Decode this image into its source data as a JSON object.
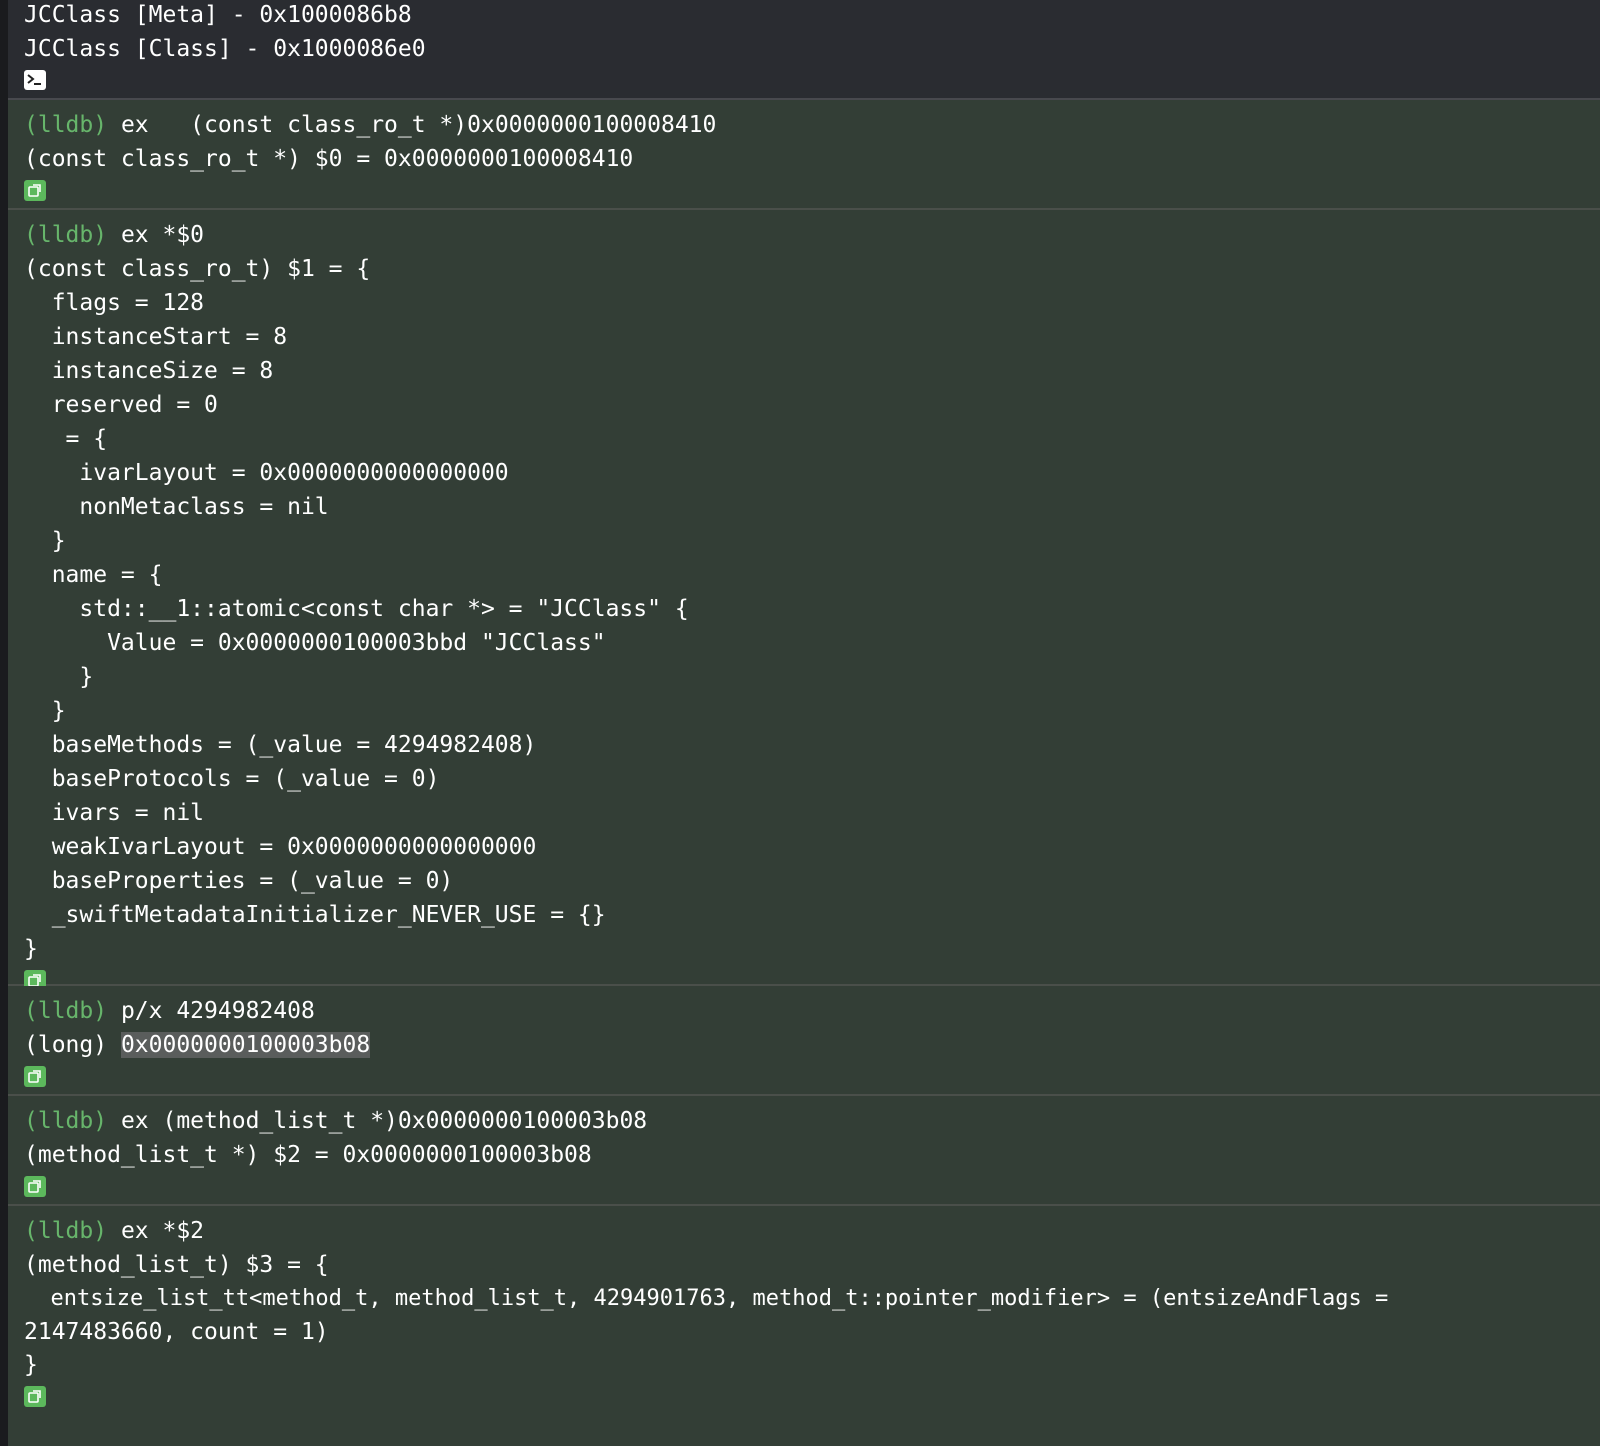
{
  "output": {
    "lines": [
      "JCClass [Meta] - 0x1000086b8",
      "JCClass [Class] - 0x1000086e0"
    ]
  },
  "blocks": [
    {
      "prompt": "(lldb)",
      "command": " ex   (const class_ro_t *)0x0000000100008410",
      "result": [
        "(const class_ro_t *) $0 = 0x0000000100008410"
      ]
    },
    {
      "prompt": "(lldb)",
      "command": " ex *$0",
      "result": [
        "(const class_ro_t) $1 = {",
        "  flags = 128",
        "  instanceStart = 8",
        "  instanceSize = 8",
        "  reserved = 0",
        "   = {",
        "    ivarLayout = 0x0000000000000000",
        "    nonMetaclass = nil",
        "  }",
        "  name = {",
        "    std::__1::atomic<const char *> = \"JCClass\" {",
        "      Value = 0x0000000100003bbd \"JCClass\"",
        "    }",
        "  }",
        "  baseMethods = (_value = 4294982408)",
        "  baseProtocols = (_value = 0)",
        "  ivars = nil",
        "  weakIvarLayout = 0x0000000000000000",
        "  baseProperties = (_value = 0)",
        "  _swiftMetadataInitializer_NEVER_USE = {}",
        "}"
      ]
    },
    {
      "prompt": "(lldb)",
      "command": " p/x 4294982408",
      "result_prefix": "(long) ",
      "result_highlight": "0x0000000100003b08"
    },
    {
      "prompt": "(lldb)",
      "command": " ex (method_list_t *)0x0000000100003b08",
      "result": [
        "(method_list_t *) $2 = 0x0000000100003b08"
      ]
    },
    {
      "prompt": "(lldb)",
      "command": " ex *$2",
      "result": [
        "(method_list_t) $3 = {",
        "  entsize_list_tt<method_t, method_list_t, 4294901763, method_t::pointer_modifier> = (entsizeAndFlags =",
        "2147483660, count = 1)",
        "}"
      ]
    }
  ],
  "icons": {
    "terminal": "terminal-icon",
    "variables": "variables-view-icon"
  },
  "colors": {
    "prompt": "#67b56b",
    "command_bg": "#333e36",
    "output_bg": "#2a2c31",
    "icon_green": "#5cb85c"
  }
}
